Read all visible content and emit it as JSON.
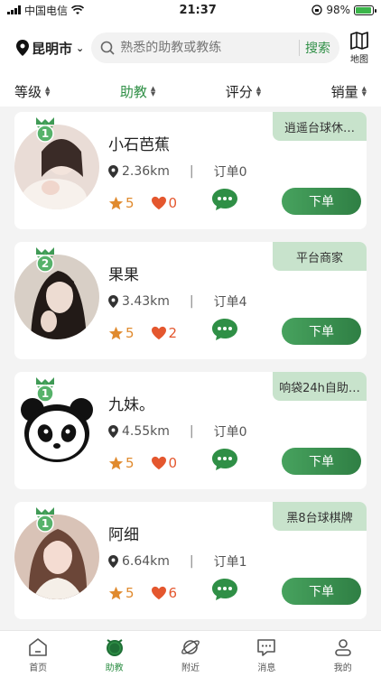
{
  "status_bar": {
    "carrier": "中国电信",
    "time": "21:37",
    "battery": "98%"
  },
  "header": {
    "city": "昆明市",
    "search_placeholder": "熟悉的助教或教练",
    "search_button": "搜索",
    "map_label": "地图"
  },
  "sort_tabs": [
    {
      "label": "等级",
      "active": false
    },
    {
      "label": "助教",
      "active": true
    },
    {
      "label": "评分",
      "active": false
    },
    {
      "label": "销量",
      "active": false
    }
  ],
  "cards": [
    {
      "level": "1",
      "name": "小石芭蕉",
      "distance": "2.36km",
      "orders": "订单0",
      "rating": "5",
      "likes": "0",
      "shop": "逍遥台球休…",
      "order_label": "下单",
      "avatar": "photo-girl-light"
    },
    {
      "level": "2",
      "name": "果果",
      "distance": "3.43km",
      "orders": "订单4",
      "rating": "5",
      "likes": "2",
      "shop": "平台商家",
      "order_label": "下单",
      "avatar": "photo-girl-dark"
    },
    {
      "level": "1",
      "name": "九妹。",
      "distance": "4.55km",
      "orders": "订单0",
      "rating": "5",
      "likes": "0",
      "shop": "响袋24h自助…",
      "order_label": "下单",
      "avatar": "panda"
    },
    {
      "level": "1",
      "name": "阿细",
      "distance": "6.64km",
      "orders": "订单1",
      "rating": "5",
      "likes": "6",
      "shop": "黑8台球棋牌",
      "order_label": "下单",
      "avatar": "photo-girl-pink"
    }
  ],
  "tab_bar": [
    {
      "label": "首页",
      "icon": "home-icon",
      "active": false
    },
    {
      "label": "助教",
      "icon": "alarm-clock-icon",
      "active": true
    },
    {
      "label": "附近",
      "icon": "planet-icon",
      "active": false
    },
    {
      "label": "消息",
      "icon": "message-icon",
      "active": false
    },
    {
      "label": "我的",
      "icon": "user-icon",
      "active": false
    }
  ],
  "colors": {
    "accent": "#2f8f46",
    "tag_bg": "#c8e3cc",
    "star": "#e08a2e",
    "heart": "#e4572e"
  }
}
